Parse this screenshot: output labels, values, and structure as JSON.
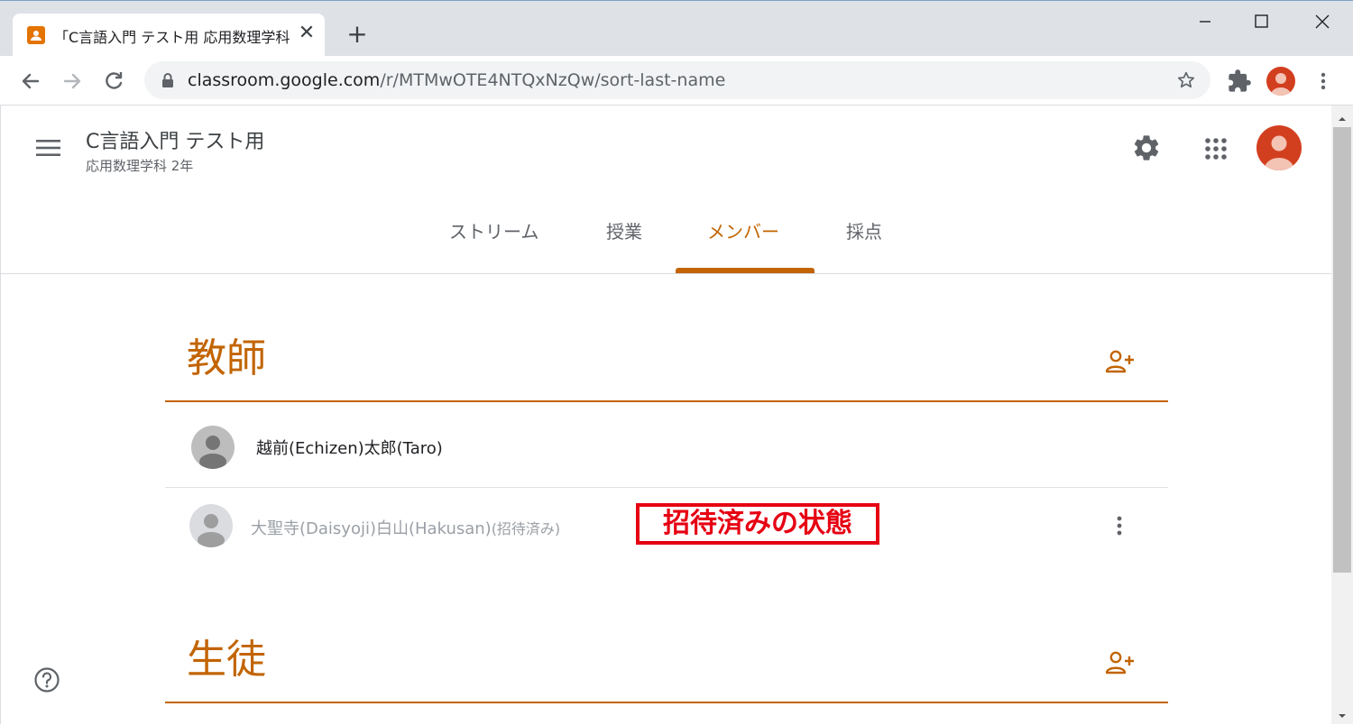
{
  "browser": {
    "tab_title": "「C言語入門 テスト用 応用数理学科",
    "new_tab_label": "+",
    "close_tab_label": "✕",
    "url_host": "classroom.google.com",
    "url_path": "/r/MTMwOTE4NTQxNzQw/sort-last-name"
  },
  "header": {
    "class_title": "C言語入門 テスト用",
    "class_section": "応用数理学科 2年"
  },
  "tabs": [
    {
      "label": "ストリーム"
    },
    {
      "label": "授業"
    },
    {
      "label": "メンバー"
    },
    {
      "label": "採点"
    }
  ],
  "active_tab": "メンバー",
  "teachers": {
    "heading": "教師",
    "people": [
      {
        "name": "越前(Echizen)太郎(Taro)"
      },
      {
        "name": "大聖寺(Daisyoji)白山(Hakusan)",
        "status": "(招待済み)"
      }
    ]
  },
  "students": {
    "heading": "生徒"
  },
  "annotation": "招待済みの状態",
  "colors": {
    "accent": "#c26401",
    "annotation": "#e60012",
    "avatar": "#d23f1f"
  }
}
